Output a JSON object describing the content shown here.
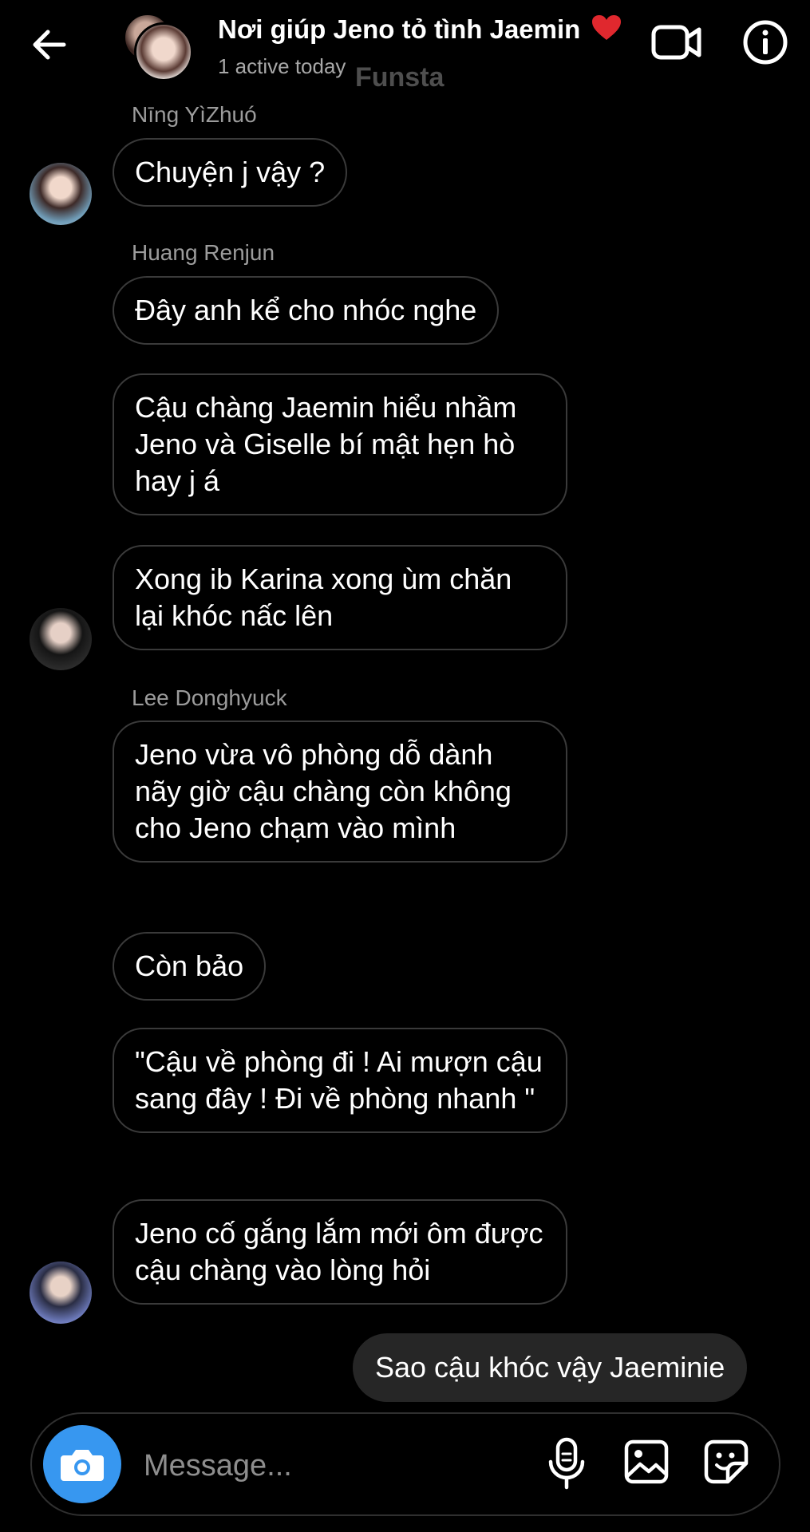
{
  "header": {
    "title": "Nơi giúp Jeno tỏ tình Jaemin",
    "status": "1 active today",
    "watermark": "Funsta",
    "heart_color": "#e0282e",
    "icons": [
      "back-arrow-icon",
      "video-call-icon",
      "info-icon"
    ]
  },
  "messages": [
    {
      "sender": "Nīng YìZhuó",
      "text": "Chuyện j vậy ?"
    },
    {
      "sender": "Huang Renjun",
      "text": "Đây anh kể cho nhóc nghe"
    },
    {
      "text": "Cậu chàng Jaemin hiểu nhầm Jeno và Giselle bí mật hẹn hò hay j á"
    },
    {
      "text": "Xong ib Karina xong ùm chăn lại khóc nấc lên"
    },
    {
      "sender": "Lee Donghyuck",
      "text": "Jeno vừa vô phòng dỗ dành nãy giờ cậu chàng còn không cho Jeno chạm vào mình"
    },
    {
      "text": "Còn bảo"
    },
    {
      "text": "\"Cậu về phòng đi ! Ai mượn cậu sang đây ! Đi về phòng nhanh \""
    },
    {
      "text": "Jeno cố gắng lắm mới ôm được cậu chàng vào lòng hỏi"
    },
    {
      "text": "Sao cậu khóc vậy Jaeminie",
      "own": true
    }
  ],
  "composer": {
    "placeholder": "Message...",
    "camera_color": "#3797f0",
    "icons": [
      "camera-icon",
      "microphone-icon",
      "gallery-icon",
      "sticker-icon"
    ]
  }
}
